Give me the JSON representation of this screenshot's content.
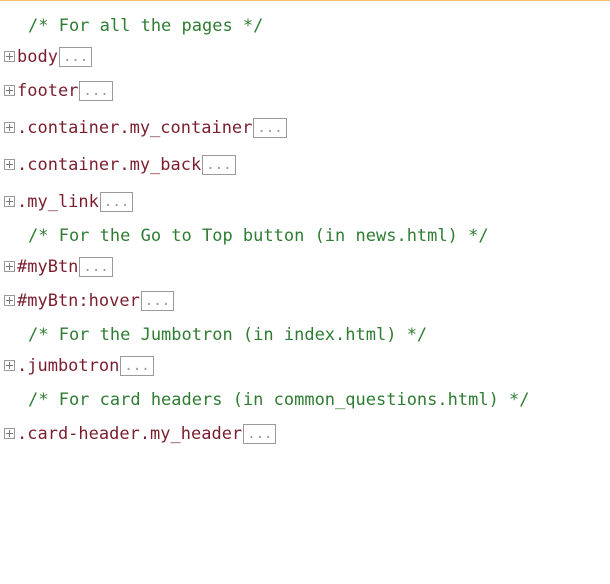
{
  "colors": {
    "comment": "#2e7d32",
    "selector": "#7a1e2e",
    "fold_border": "#9a9a9a",
    "top_rule": "#f0c36d"
  },
  "icons": {
    "fold_toggle": "plus-box-icon",
    "collapsed_marker": "ellipsis-box"
  },
  "lines": [
    {
      "type": "comment",
      "text": "/* For all the pages */"
    },
    {
      "type": "rule",
      "selector": "body",
      "collapsed": "..."
    },
    {
      "type": "rule",
      "selector": "footer",
      "collapsed": "..."
    },
    {
      "type": "rule",
      "selector": ".container.my_container",
      "collapsed": "..."
    },
    {
      "type": "rule",
      "selector": ".container.my_back",
      "collapsed": "..."
    },
    {
      "type": "rule",
      "selector": ".my_link",
      "collapsed": "..."
    },
    {
      "type": "comment",
      "text": "/* For the Go to Top button (in news.html) */"
    },
    {
      "type": "rule",
      "selector": "#myBtn",
      "collapsed": "..."
    },
    {
      "type": "rule",
      "selector": "#myBtn:hover",
      "collapsed": "..."
    },
    {
      "type": "comment",
      "text": "/* For the Jumbotron (in index.html) */"
    },
    {
      "type": "rule",
      "selector": ".jumbotron",
      "collapsed": "..."
    },
    {
      "type": "comment",
      "text": "/* For card headers (in common_questions.html) */"
    },
    {
      "type": "rule",
      "selector": ".card-header.my_header",
      "collapsed": "..."
    }
  ]
}
